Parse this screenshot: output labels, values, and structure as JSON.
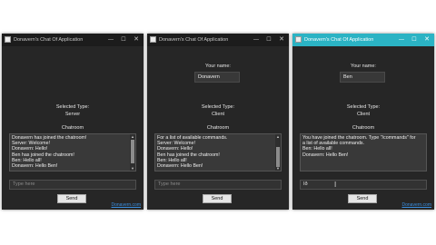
{
  "window_title": "Donavern's Chat Of Application",
  "window_controls": {
    "minimize": "—",
    "maximize": "☐",
    "close": "✕"
  },
  "labels": {
    "your_name": "Your name:",
    "selected_type": "Selected Type:",
    "chatroom": "Chatroom",
    "input_placeholder": "Type here",
    "send": "Send",
    "footer_link": "Donavern.com"
  },
  "windows": [
    {
      "type": "Server",
      "messages": [
        "Donavern has joined the chatroom!",
        "Server: Welcome!",
        "Donavern: Hello!",
        "Ben has joined the chatroom!",
        "Ben: Hello all!",
        "Donavern: Hello Ben!"
      ],
      "input_value": ""
    },
    {
      "name": "Donavern",
      "type": "Client",
      "messages": [
        "For a list of available commands.",
        "Server: Welcome!",
        "Donavern: Hello!",
        "Ben has joined the chatroom!",
        "Ben: Hello all!",
        "Donavern: Hello Ben!"
      ],
      "input_value": ""
    },
    {
      "name": "Ben",
      "type": "Client",
      "messages": [
        "You have joined the chatroom. Type \"/commands\" for a list of available commands.",
        "Ben: Hello all!",
        "Donavern: Hello Ben!"
      ],
      "input_value": "Ið"
    }
  ],
  "colors": {
    "window_bg": "#262626",
    "title_bar": "#1c1c1c",
    "title_bar_active": "#2bb3c4",
    "chat_bg": "#393939",
    "link": "#3a8fe0"
  },
  "icons": [
    "app-icon",
    "minimize-icon",
    "maximize-icon",
    "close-icon",
    "scroll-up-arrow-icon",
    "scroll-down-arrow-icon",
    "text-cursor-icon"
  ]
}
